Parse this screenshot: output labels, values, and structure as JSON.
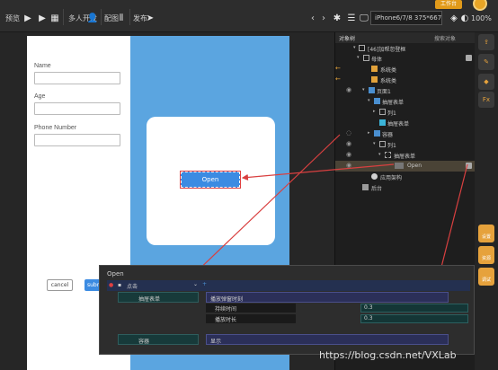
{
  "toolbar": {
    "preview_label": "预览",
    "multi_user_label": "多人开发",
    "layout_label": "配图",
    "publish_label": "发布",
    "device_label": "iPhone6/7/8 375*667",
    "zoom_label": "100%",
    "workbench_label": "工作台"
  },
  "object_panel": {
    "title": "对象树",
    "search_placeholder": "搜索对象",
    "rows": [
      {
        "label": "[46]加帮忽登框"
      },
      {
        "label": "母体"
      },
      {
        "label": "系统类"
      },
      {
        "label": "系统类"
      },
      {
        "label": "页面1"
      },
      {
        "label": "抽屉表单"
      },
      {
        "label": "列1"
      },
      {
        "label": "抽屉表单"
      },
      {
        "label": "容器"
      },
      {
        "label": "列1"
      },
      {
        "label": "抽屉表单"
      },
      {
        "label": "Open"
      },
      {
        "label": "应用架构"
      },
      {
        "label": "后台"
      }
    ]
  },
  "form": {
    "name_label": "Name",
    "age_label": "Age",
    "phone_label": "Phone Number",
    "cancel_label": "cancel",
    "submit_label": "submit"
  },
  "dialog": {
    "open_label": "Open"
  },
  "dock": {
    "item1": "设置",
    "item2": "资源",
    "item3": "调试"
  },
  "interaction": {
    "title": "Open",
    "event_label": "点击",
    "action1_target": "抽屉表单",
    "action1_effect": "播放弹窗时刻",
    "param1_label": "持续时间",
    "param1_value": "0.3",
    "param2_label": "播放时长",
    "param2_value": "0.3",
    "action2_target": "容器",
    "action2_effect": "显示"
  },
  "watermark": "https://blog.csdn.net/VXLab"
}
